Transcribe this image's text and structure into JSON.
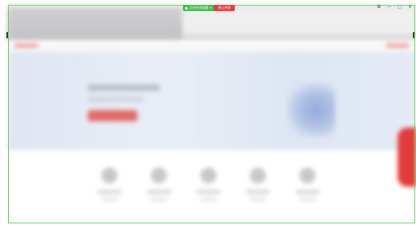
{
  "share_bar": {
    "status_label": "正在共享屏幕",
    "chevron": "▾",
    "stop_label": "停止共享"
  },
  "window_controls": {
    "settings": "⚙",
    "minimize": "—",
    "maximize": "□",
    "close": "✕"
  },
  "colors": {
    "share_green": "#3fbf4a",
    "stop_red": "#ea3b3b",
    "frame_green": "#5ed35e",
    "hero_bg": "#dfe6f2",
    "accent_red": "#e46a6a"
  },
  "features": [
    {
      "icon": "feature-icon-1"
    },
    {
      "icon": "feature-icon-2"
    },
    {
      "icon": "feature-icon-3"
    },
    {
      "icon": "feature-icon-4"
    },
    {
      "icon": "feature-icon-5"
    }
  ]
}
